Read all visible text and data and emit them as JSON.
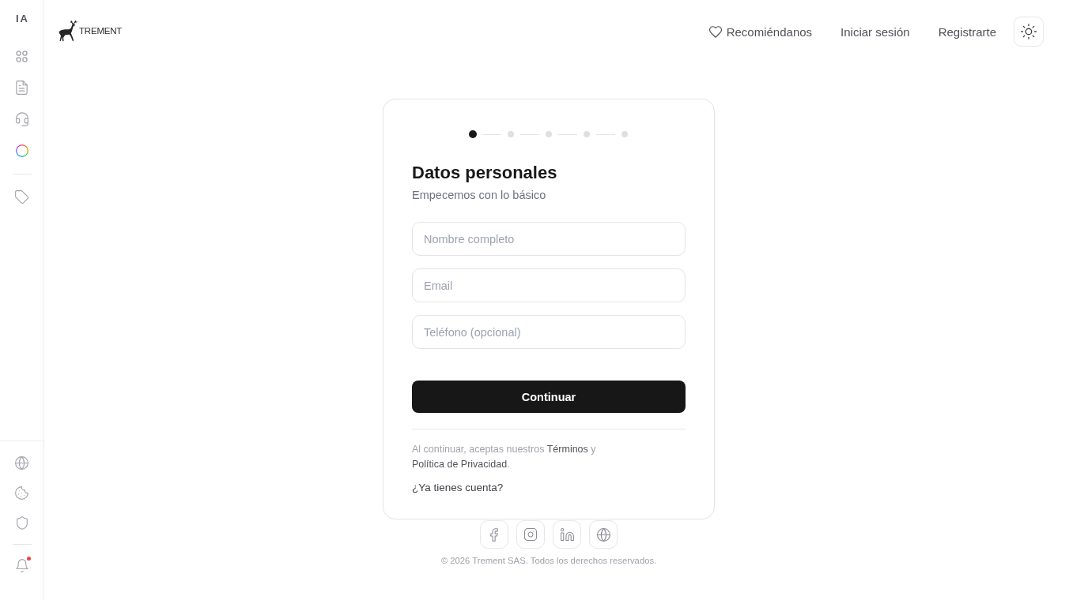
{
  "sidebar": {
    "label": "IA",
    "notification_dot": true
  },
  "header": {
    "logo_text": "TREMENT",
    "nav_links": [
      {
        "kind": "icon",
        "label": "Recomiéndanos"
      },
      {
        "kind": "text",
        "label": "Iniciar sesión"
      },
      {
        "kind": "text",
        "label": "Registrarte"
      }
    ]
  },
  "stepper": {
    "steps": [
      {
        "active": true
      },
      {
        "active": false
      },
      {
        "active": false
      },
      {
        "active": false
      },
      {
        "active": false
      }
    ]
  },
  "form": {
    "title": "Datos personales",
    "subtitle": "Empecemos con lo básico",
    "fields": [
      {
        "placeholder": "Nombre completo"
      },
      {
        "placeholder": "Email"
      },
      {
        "placeholder": "Teléfono (opcional)"
      }
    ],
    "submit": "Continuar",
    "terms": [
      {
        "kind": "text",
        "text": "Al continuar, aceptas nuestros "
      },
      {
        "kind": "link",
        "text": "Términos"
      },
      {
        "kind": "text",
        "text": " y "
      },
      {
        "kind": "link",
        "text": "Política de Privacidad"
      },
      {
        "kind": "text",
        "text": "."
      }
    ],
    "login_prompt": "¿Ya tienes cuenta?"
  },
  "footer": {
    "copyright": "© 2026 Trement SAS. Todos los derechos reservados."
  }
}
